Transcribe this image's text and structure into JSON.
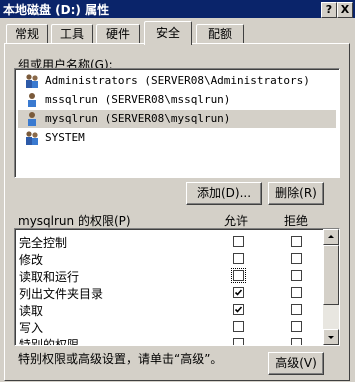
{
  "window": {
    "title": "本地磁盘 (D:) 属性",
    "help_label": "?",
    "close_label": "X"
  },
  "tabs": [
    {
      "label": "常规"
    },
    {
      "label": "工具"
    },
    {
      "label": "硬件"
    },
    {
      "label": "安全",
      "active": true
    },
    {
      "label": "配额"
    }
  ],
  "groups": {
    "label": "组或用户名称(G):",
    "items": [
      {
        "text": "Administrators (SERVER08\\Administrators)",
        "icon": "group-icon",
        "selected": false
      },
      {
        "text": "mssqlrun (SERVER08\\mssqlrun)",
        "icon": "user-icon",
        "selected": false
      },
      {
        "text": "mysqlrun (SERVER08\\mysqlrun)",
        "icon": "user-icon",
        "selected": true
      },
      {
        "text": "SYSTEM",
        "icon": "group-icon",
        "selected": false
      }
    ]
  },
  "buttons": {
    "add": "添加(D)...",
    "remove": "删除(R)",
    "advanced": "高级(V)"
  },
  "permissions": {
    "label": "mysqlrun 的权限(P)",
    "allow_header": "允许",
    "deny_header": "拒绝",
    "rows": [
      {
        "name": "完全控制",
        "allow": false,
        "deny": false
      },
      {
        "name": "修改",
        "allow": false,
        "deny": false
      },
      {
        "name": "读取和运行",
        "allow": false,
        "deny": false
      },
      {
        "name": "列出文件夹目录",
        "allow": true,
        "deny": false
      },
      {
        "name": "读取",
        "allow": true,
        "deny": false
      },
      {
        "name": "写入",
        "allow": false,
        "deny": false
      },
      {
        "name": "特别的权限",
        "allow": false,
        "deny": false
      }
    ]
  },
  "footer": {
    "note": "特别权限或高级设置，请单击“高级”。"
  }
}
